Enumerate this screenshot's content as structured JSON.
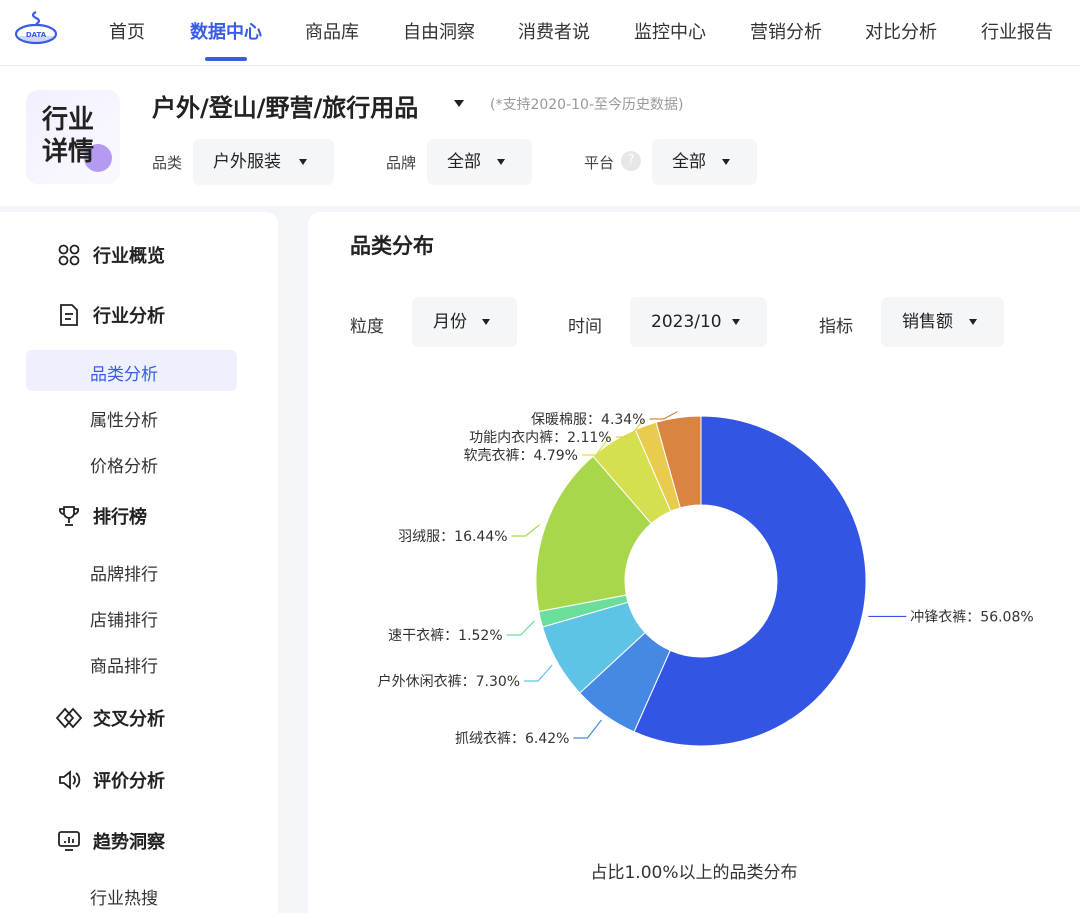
{
  "nav": {
    "items": [
      {
        "label": "首页",
        "active": false
      },
      {
        "label": "数据中心",
        "active": true
      },
      {
        "label": "商品库",
        "active": false
      },
      {
        "label": "自由洞察",
        "active": false
      },
      {
        "label": "消费者说",
        "active": false
      },
      {
        "label": "监控中心",
        "active": false
      },
      {
        "label": "营销分析",
        "active": false
      },
      {
        "label": "对比分析",
        "active": false
      },
      {
        "label": "行业报告",
        "active": false
      }
    ],
    "accent": "#3a5be6",
    "logo_text": "DATA"
  },
  "header": {
    "badge_text": "行业\n详情",
    "industry": "户外/登山/野营/旅行用品",
    "note": "(*支持2020-10-至今历史数据)",
    "filters": {
      "category_label": "品类",
      "category_value": "户外服装",
      "brand_label": "品牌",
      "brand_value": "全部",
      "platform_label": "平台",
      "platform_help": "?",
      "platform_value": "全部"
    }
  },
  "sidebar": {
    "overview": "行业概览",
    "analysis": "行业分析",
    "analysis_items": [
      "品类分析",
      "属性分析",
      "价格分析"
    ],
    "ranking": "排行榜",
    "ranking_items": [
      "品牌排行",
      "店铺排行",
      "商品排行"
    ],
    "cross": "交叉分析",
    "review": "评价分析",
    "trend": "趋势洞察",
    "trend_items": [
      "行业热搜"
    ]
  },
  "main": {
    "title": "品类分布",
    "controls": {
      "granularity_label": "粒度",
      "granularity_value": "月份",
      "time_label": "时间",
      "time_value": "2023/10",
      "metric_label": "指标",
      "metric_value": "销售额"
    },
    "caption": "占比1.00%以上的品类分布"
  },
  "chart_data": {
    "type": "pie",
    "donut": true,
    "title": "",
    "caption": "占比1.00%以上的品类分布",
    "unit": "%",
    "slices": [
      {
        "label": "冲锋衣裤",
        "value": 56.08,
        "color": "#3355e3"
      },
      {
        "label": "抓绒衣裤",
        "value": 6.42,
        "color": "#4589e4"
      },
      {
        "label": "户外休闲衣裤",
        "value": 7.3,
        "color": "#5fc3e8"
      },
      {
        "label": "速干衣裤",
        "value": 1.52,
        "color": "#6bde9c"
      },
      {
        "label": "羽绒服",
        "value": 16.44,
        "color": "#a9d74b"
      },
      {
        "label": "软壳衣裤",
        "value": 4.79,
        "color": "#d5e050"
      },
      {
        "label": "功能内衣内裤",
        "value": 2.11,
        "color": "#e9cb4e"
      },
      {
        "label": "保暖棉服",
        "value": 4.34,
        "color": "#da8442"
      }
    ]
  }
}
